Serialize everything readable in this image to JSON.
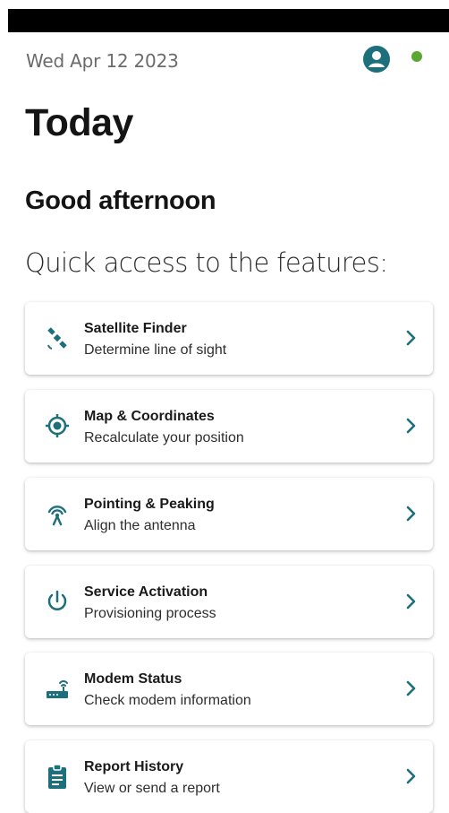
{
  "header": {
    "date": "Wed Apr 12 2023",
    "account_icon": "account-circle-icon",
    "status_color": "#5aa832"
  },
  "title": "Today",
  "greeting": "Good afternoon",
  "quick_access": "Quick access to the features:",
  "accent_color": "#1d6f7c",
  "features": [
    {
      "title": "Satellite Finder",
      "subtitle": "Determine line of sight",
      "icon": "satellite-icon"
    },
    {
      "title": "Map & Coordinates",
      "subtitle": "Recalculate your position",
      "icon": "location-target-icon"
    },
    {
      "title": "Pointing & Peaking",
      "subtitle": "Align the antenna",
      "icon": "antenna-signal-icon"
    },
    {
      "title": "Service Activation",
      "subtitle": "Provisioning process",
      "icon": "power-icon"
    },
    {
      "title": "Modem Status",
      "subtitle": "Check modem information",
      "icon": "modem-icon"
    },
    {
      "title": "Report History",
      "subtitle": "View or send a report",
      "icon": "clipboard-icon"
    }
  ]
}
